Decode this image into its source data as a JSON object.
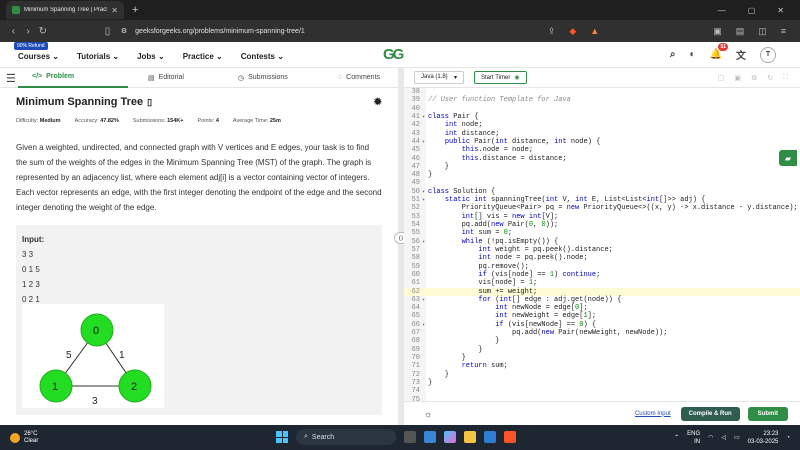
{
  "browser": {
    "tab_title": "Minimum Spanning Tree | Practice",
    "url": "geeksforgeeks.org/problems/minimum-spanning-tree/1"
  },
  "site": {
    "badge": "90% Refund",
    "menus": [
      "Courses",
      "Tutorials",
      "Jobs",
      "Practice",
      "Contests"
    ],
    "logo": "GG",
    "notif_count": "51",
    "avatar": "T"
  },
  "left_tabs": [
    "Problem",
    "Editorial",
    "Submissions",
    "Comments"
  ],
  "problem": {
    "title": "Minimum Spanning Tree",
    "difficulty_label": "Difficulty:",
    "difficulty": "Medium",
    "accuracy_label": "Accuracy:",
    "accuracy": "47.82%",
    "submissions_label": "Submissions:",
    "submissions": "154K+",
    "points_label": "Points:",
    "points": "4",
    "avgtime_label": "Average Time:",
    "avgtime": "25m",
    "description": "Given a weighted, undirected, and connected graph with V vertices and E edges, your task is to find the sum of the weights of the edges in the Minimum Spanning Tree (MST) of the graph. The graph is represented by an adjacency list, where each element adj[i] is a vector containing vector of integers. Each vector represents an edge, with the first integer denoting the endpoint of the edge and the second integer denoting the weight of the edge.",
    "input_label": "Input:",
    "input_lines": [
      "3 3",
      "0 1 5",
      "1 2 3",
      "0 2 1"
    ],
    "graph": {
      "nodes": [
        "0",
        "1",
        "2"
      ],
      "edges": [
        {
          "from": "0",
          "to": "1",
          "w": "5"
        },
        {
          "from": "0",
          "to": "2",
          "w": "1"
        },
        {
          "from": "1",
          "to": "2",
          "w": "3"
        }
      ],
      "node_color": "#22dd22"
    }
  },
  "editor": {
    "language": "Java (1.8)",
    "timer": "Start Timer",
    "lines": [
      {
        "n": "38",
        "t": ""
      },
      {
        "n": "39",
        "t": "// User function Template for Java"
      },
      {
        "n": "40",
        "t": ""
      },
      {
        "n": "41",
        "t": "class Pair {",
        "f": "▾"
      },
      {
        "n": "42",
        "t": "    int node;"
      },
      {
        "n": "43",
        "t": "    int distance;"
      },
      {
        "n": "44",
        "t": "    public Pair(int distance, int node) {",
        "f": "▾"
      },
      {
        "n": "45",
        "t": "        this.node = node;"
      },
      {
        "n": "46",
        "t": "        this.distance = distance;"
      },
      {
        "n": "47",
        "t": "    }"
      },
      {
        "n": "48",
        "t": "}"
      },
      {
        "n": "49",
        "t": ""
      },
      {
        "n": "50",
        "t": "class Solution {",
        "f": "▾"
      },
      {
        "n": "51",
        "t": "    static int spanningTree(int V, int E, List<List<int[]>> adj) {",
        "f": "▾"
      },
      {
        "n": "52",
        "t": "        PriorityQueue<Pair> pq = new PriorityQueue<>((x, y) -> x.distance - y.distance);"
      },
      {
        "n": "53",
        "t": "        int[] vis = new int[V];"
      },
      {
        "n": "54",
        "t": "        pq.add(new Pair(0, 0));"
      },
      {
        "n": "55",
        "t": "        int sum = 0;"
      },
      {
        "n": "56",
        "t": "        while (!pq.isEmpty()) {",
        "f": "▾"
      },
      {
        "n": "57",
        "t": "            int weight = pq.peek().distance;"
      },
      {
        "n": "58",
        "t": "            int node = pq.peek().node;"
      },
      {
        "n": "59",
        "t": "            pq.remove();"
      },
      {
        "n": "60",
        "t": "            if (vis[node] == 1) continue;"
      },
      {
        "n": "61",
        "t": "            vis[node] = 1;"
      },
      {
        "n": "62",
        "t": "            sum += weight;",
        "hl": true
      },
      {
        "n": "63",
        "t": "            for (int[] edge : adj.get(node)) {",
        "f": "▾"
      },
      {
        "n": "64",
        "t": "                int newNode = edge[0];"
      },
      {
        "n": "65",
        "t": "                int newWeight = edge[1];"
      },
      {
        "n": "66",
        "t": "                if (vis[newNode] == 0) {",
        "f": "▾"
      },
      {
        "n": "67",
        "t": "                    pq.add(new Pair(newWeight, newNode));"
      },
      {
        "n": "68",
        "t": "                }"
      },
      {
        "n": "69",
        "t": "            }"
      },
      {
        "n": "70",
        "t": "        }"
      },
      {
        "n": "71",
        "t": "        return sum;"
      },
      {
        "n": "72",
        "t": "    }"
      },
      {
        "n": "73",
        "t": "}"
      },
      {
        "n": "74",
        "t": ""
      },
      {
        "n": "75",
        "t": ""
      }
    ],
    "custom_input": "Custom Input",
    "compile_run": "Compile & Run",
    "submit": "Submit"
  },
  "taskbar": {
    "temp": "26°C",
    "weather": "Clear",
    "search": "Search",
    "lang1": "ENG",
    "lang2": "IN",
    "time": "23:23",
    "date": "03-03-2025"
  }
}
